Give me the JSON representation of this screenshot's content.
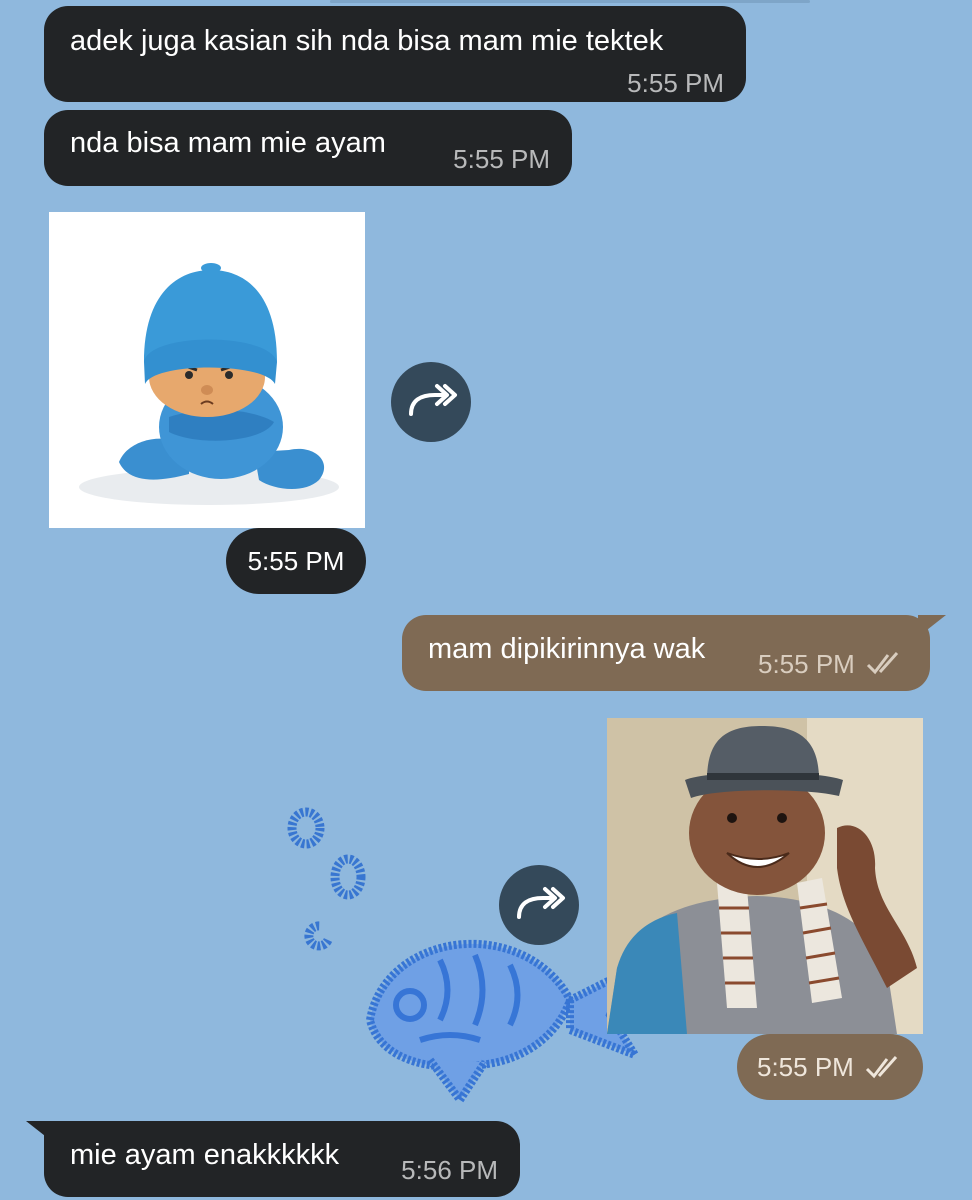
{
  "colors": {
    "background": "#8fb8dd",
    "incoming_bubble": "#222426",
    "outgoing_bubble": "#7f6a54",
    "forward_button": "#34495a"
  },
  "messages": [
    {
      "direction": "in",
      "text": "adek juga kasian sih nda bisa mam mie tektek",
      "time": "5:55 PM"
    },
    {
      "direction": "in",
      "text": "nda bisa mam mie ayam",
      "time": "5:55 PM"
    },
    {
      "direction": "in",
      "type": "sticker",
      "sticker": "pocoyo-sitting-arms-crossed",
      "time": "5:55 PM",
      "action_icon": "forward-icon"
    },
    {
      "direction": "out",
      "text": "mam dipikirinnya wak",
      "time": "5:55 PM",
      "status_icon": "double-check-icon"
    },
    {
      "direction": "out",
      "type": "sticker",
      "sticker": "man-with-hat-scarf-smiling",
      "time": "5:55 PM",
      "status_icon": "double-check-icon",
      "action_icon": "forward-icon"
    },
    {
      "direction": "in",
      "text": "mie ayam enakkkkkk",
      "time": "5:56 PM"
    }
  ],
  "background_doodles": [
    "fish-doodle",
    "bubbles-doodle"
  ]
}
